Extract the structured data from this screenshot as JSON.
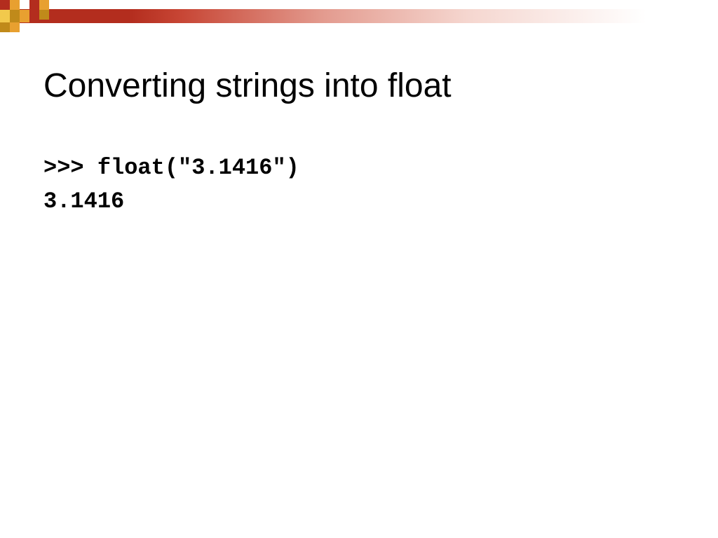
{
  "slide": {
    "title": "Converting strings into float",
    "code": {
      "line1": ">>> float(\"3.1416\")",
      "line2": "3.1416"
    }
  },
  "colors": {
    "red_bar": "#b32d1e",
    "gold_dark": "#c08a1a",
    "gold_light": "#e8a030",
    "yellow": "#f2c94c"
  }
}
